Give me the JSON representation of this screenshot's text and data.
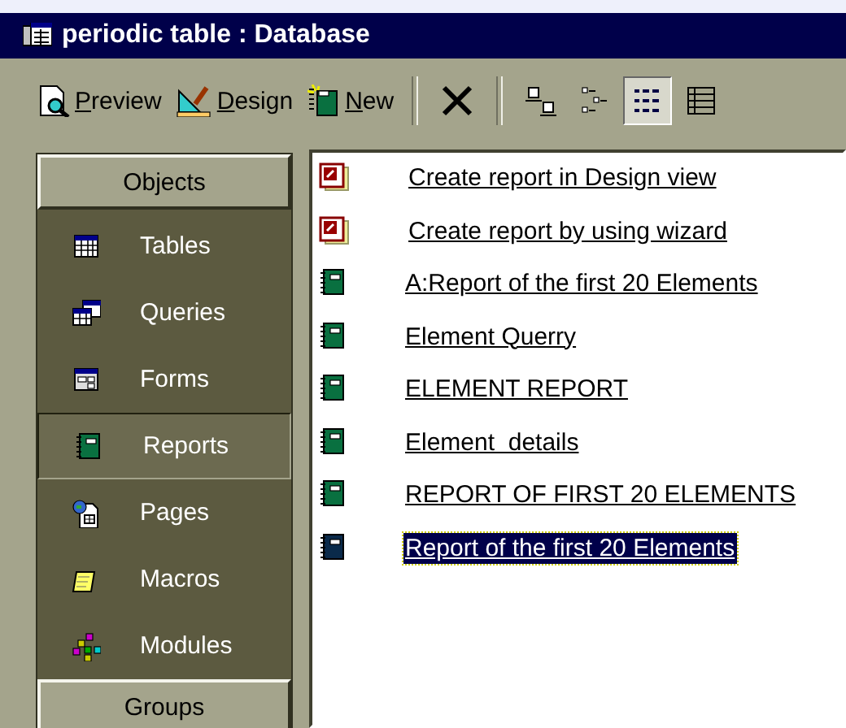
{
  "window": {
    "title": "periodic table : Database"
  },
  "toolbar": {
    "buttons": [
      {
        "label": "Preview",
        "kind": "preview"
      },
      {
        "label": "Design",
        "kind": "design"
      },
      {
        "label": "New",
        "kind": "new"
      }
    ],
    "views": [
      {
        "kind": "large",
        "selected": false
      },
      {
        "kind": "small",
        "selected": false
      },
      {
        "kind": "list",
        "selected": true
      },
      {
        "kind": "details",
        "selected": false
      }
    ]
  },
  "sidebar": {
    "header": "Objects",
    "items": [
      {
        "label": "Tables",
        "kind": "tables",
        "selected": false
      },
      {
        "label": "Queries",
        "kind": "queries",
        "selected": false
      },
      {
        "label": "Forms",
        "kind": "forms",
        "selected": false
      },
      {
        "label": "Reports",
        "kind": "reports",
        "selected": true
      },
      {
        "label": "Pages",
        "kind": "pages",
        "selected": false
      },
      {
        "label": "Macros",
        "kind": "macros",
        "selected": false
      },
      {
        "label": "Modules",
        "kind": "modules",
        "selected": false
      }
    ],
    "footer": "Groups"
  },
  "list": {
    "items": [
      {
        "label": "Create report in Design view",
        "kind": "shortcut",
        "selected": false
      },
      {
        "label": "Create report by using wizard",
        "kind": "shortcut",
        "selected": false
      },
      {
        "label": "A:Report of the first 20 Elements",
        "kind": "report",
        "selected": false
      },
      {
        "label": "Element Querry",
        "kind": "report",
        "selected": false
      },
      {
        "label": "ELEMENT REPORT",
        "kind": "report",
        "selected": false
      },
      {
        "label": "Element  details",
        "kind": "report",
        "selected": false
      },
      {
        "label": "REPORT OF FIRST 20 ELEMENTS",
        "kind": "report",
        "selected": false
      },
      {
        "label": "Report of the first 20 Elements",
        "kind": "report",
        "selected": true
      }
    ]
  }
}
